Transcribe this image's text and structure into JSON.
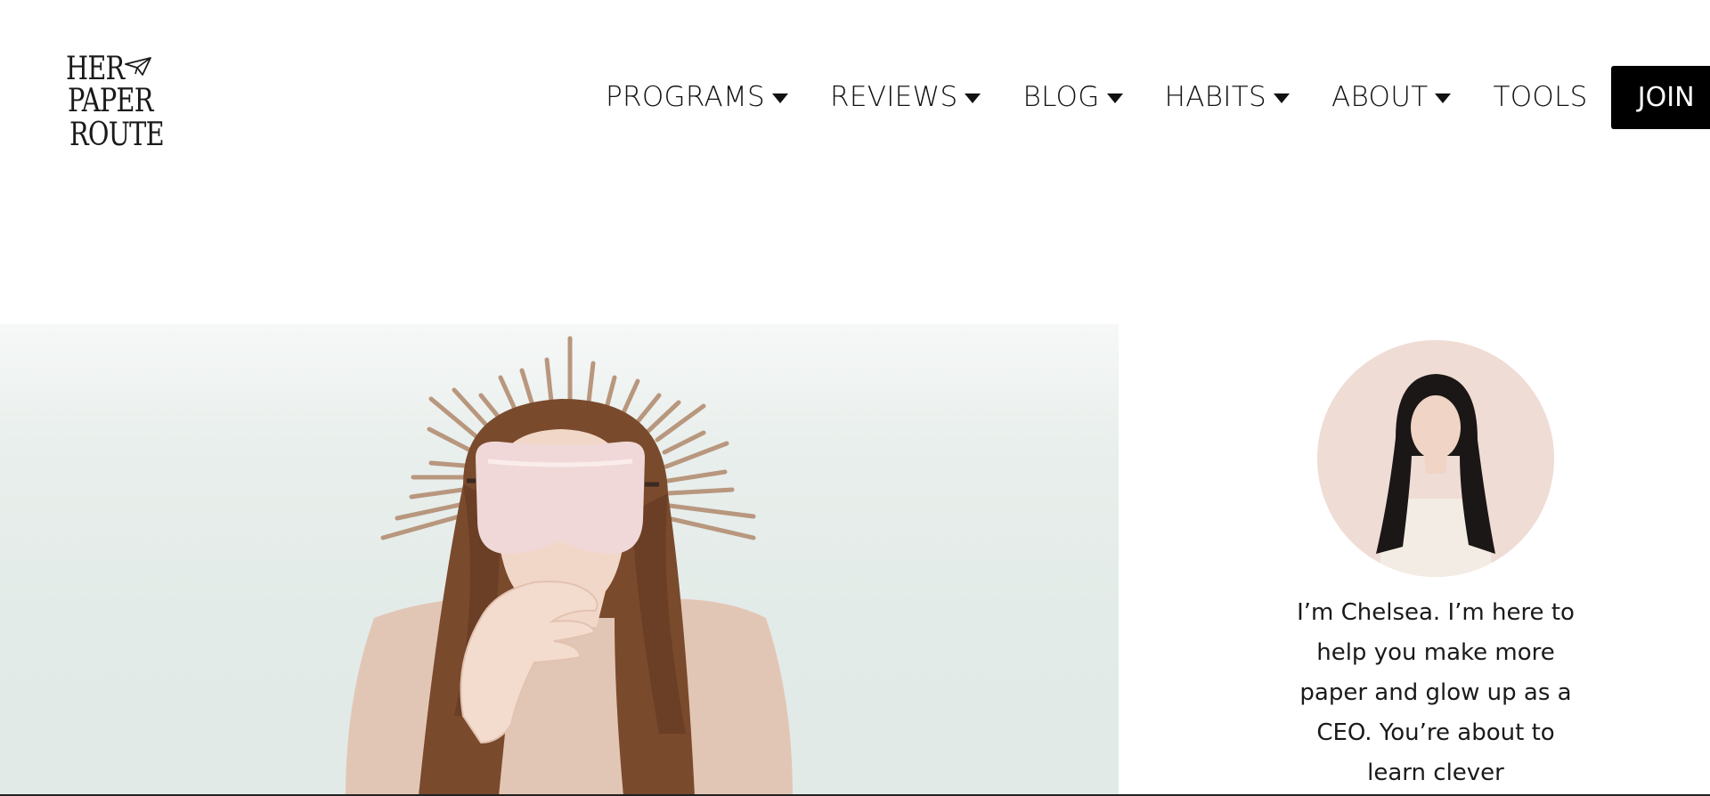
{
  "brand": {
    "logo_lines": [
      "HER",
      "PAPER",
      "ROUTE"
    ]
  },
  "nav": {
    "items": [
      {
        "label": "PROGRAMS",
        "has_dropdown": true
      },
      {
        "label": "REVIEWS",
        "has_dropdown": true
      },
      {
        "label": "BLOG",
        "has_dropdown": true
      },
      {
        "label": "HABITS",
        "has_dropdown": true
      },
      {
        "label": "ABOUT",
        "has_dropdown": true
      },
      {
        "label": "TOOLS",
        "has_dropdown": false
      }
    ],
    "join_label": "JOIN",
    "search_icon": "search-icon"
  },
  "colors": {
    "accent_button": "#000000",
    "hero_bg": "#e3ebe8",
    "avatar_bg": "#efdcd5"
  },
  "author": {
    "bio": "I’m Chelsea. I’m here to help you make more paper and glow up as a CEO. You’re about to learn clever"
  }
}
